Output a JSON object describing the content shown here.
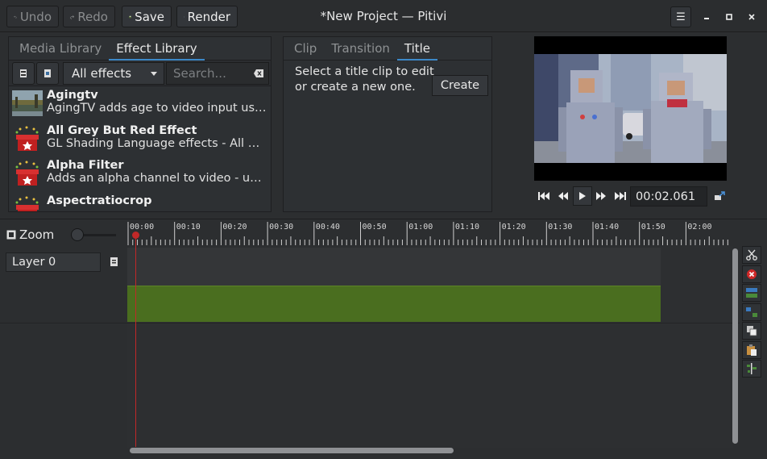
{
  "header": {
    "undo_label": "Undo",
    "redo_label": "Redo",
    "save_label": "Save",
    "render_label": "Render",
    "window_title": "*New Project — Pitivi"
  },
  "library": {
    "tabs": [
      "Media Library",
      "Effect Library"
    ],
    "active_tab": "Effect Library",
    "filter_value": "All effects",
    "search_placeholder": "Search...",
    "effects": [
      {
        "name": "Agingtv",
        "desc": "AgingTV adds age to video input using s...",
        "icon": "aging-thumbnail"
      },
      {
        "name": "All Grey But Red Effect",
        "desc": "GL Shading Language effects - All Grey ...",
        "icon": "gift-box-icon"
      },
      {
        "name": "Alpha Filter",
        "desc": "Adds an alpha channel to video - unifor...",
        "icon": "gift-box-icon"
      },
      {
        "name": "Aspectratiocrop",
        "desc": "",
        "icon": "gift-box-icon"
      }
    ]
  },
  "clip_panel": {
    "tabs": [
      "Clip",
      "Transition",
      "Title"
    ],
    "active_tab": "Title",
    "message_line1": "Select a title clip to edit",
    "message_line2": "or create a new one.",
    "create_label": "Create"
  },
  "viewer": {
    "timecode": "00:02.061"
  },
  "timeline": {
    "zoom_label": "Zoom",
    "layer_name": "Layer 0",
    "ruler_labels": [
      "00:00",
      "00:10",
      "00:20",
      "00:30",
      "00:40",
      "00:50",
      "01:00",
      "01:10",
      "01:20",
      "01:30",
      "01:40",
      "01:50",
      "02:00"
    ],
    "clip_color": "#4a6e1f",
    "playhead_color": "#c02828"
  },
  "accent": "#3c88c8"
}
